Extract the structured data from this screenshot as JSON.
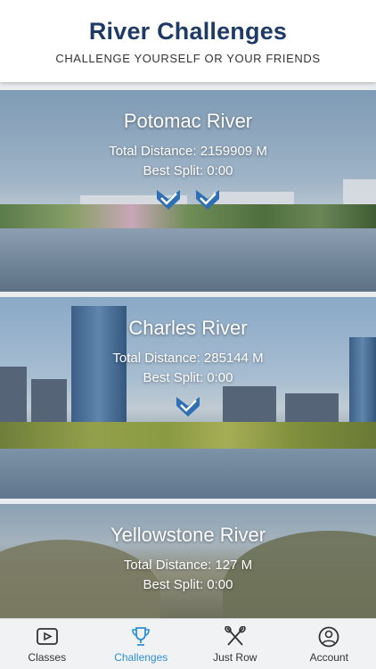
{
  "header": {
    "title": "River Challenges",
    "subtitle": "CHALLENGE YOURSELF OR YOUR FRIENDS"
  },
  "challenges": [
    {
      "name": "Potomac River",
      "distance_label": "Total Distance:",
      "distance": "2159909 M",
      "split_label": "Best Split:",
      "split": "0:00",
      "completed_marks": 2
    },
    {
      "name": "Charles River",
      "distance_label": "Total Distance:",
      "distance": "285144 M",
      "split_label": "Best Split:",
      "split": "0:00",
      "completed_marks": 1
    },
    {
      "name": "Yellowstone River",
      "distance_label": "Total Distance:",
      "distance": "127 M",
      "split_label": "Best Split:",
      "split": "0:00",
      "completed_marks": 0
    }
  ],
  "tabs": [
    {
      "label": "Classes",
      "icon": "video-play-icon",
      "active": false
    },
    {
      "label": "Challenges",
      "icon": "trophy-icon",
      "active": true
    },
    {
      "label": "Just Row",
      "icon": "crossed-oars-icon",
      "active": false
    },
    {
      "label": "Account",
      "icon": "user-icon",
      "active": false
    }
  ],
  "colors": {
    "title": "#1f3a66",
    "active_tab": "#2f8fd6",
    "check_badge": "#2f6fb4"
  }
}
